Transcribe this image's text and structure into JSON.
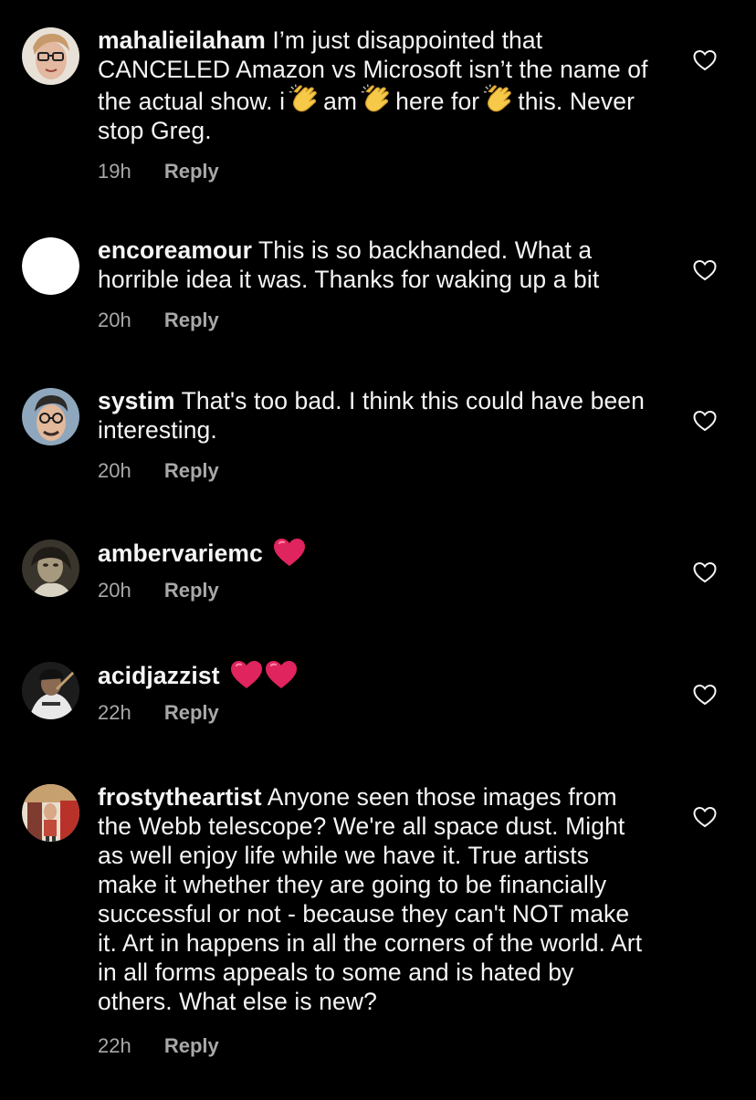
{
  "comments": [
    {
      "username": "mahalieilaham",
      "text_parts": [
        "I’m just disappointed that CANCELED Amazon vs Microsoft isn’t the name of the actual show. i",
        "am",
        "here for",
        "this. Never stop Greg."
      ],
      "time": "19h",
      "reply": "Reply",
      "avatar": "woman-glasses-avatar",
      "emoji": "clapping-hands-emoji"
    },
    {
      "username": "encoreamour",
      "text": "This is so backhanded. What a horrible idea it was. Thanks for waking up a bit",
      "time": "20h",
      "reply": "Reply",
      "avatar": "white-circle-avatar"
    },
    {
      "username": "systim",
      "text": "That's too bad. I think this could have been interesting.",
      "time": "20h",
      "reply": "Reply",
      "avatar": "man-glasses-avatar"
    },
    {
      "username": "ambervariemc",
      "text": "",
      "time": "20h",
      "reply": "Reply",
      "avatar": "sepia-portrait-avatar",
      "emoji": "red-heart-emoji",
      "emoji_count": 1
    },
    {
      "username": "acidjazzist",
      "text": "",
      "time": "22h",
      "reply": "Reply",
      "avatar": "baseball-player-avatar",
      "emoji": "red-heart-emoji",
      "emoji_count": 2
    },
    {
      "username": "frostytheartist",
      "text": "Anyone seen those images from the Webb telescope? We're all space dust. Might as well enjoy life while we have it. True artists make it whether they are going to be financially successful or not - because they can't NOT make it. Art in happens in all the corners of the world. Art in all forms appeals to some and is hated by others. What else is new?",
      "time": "22h",
      "reply": "Reply",
      "avatar": "colorful-photo-avatar"
    }
  ],
  "icons": {
    "like": "heart-outline-icon"
  },
  "colors": {
    "background": "#000000",
    "text": "#f5f5f5",
    "meta": "#a8a8a8",
    "heart_emoji": "#e0245e",
    "clap_emoji": "#f7c948"
  }
}
